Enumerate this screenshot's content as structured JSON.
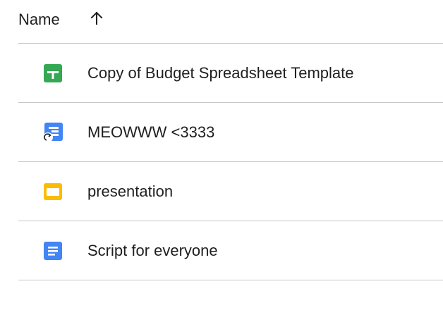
{
  "header": {
    "name_label": "Name",
    "sort_icon": "arrow-up-icon"
  },
  "files": [
    {
      "name": "Copy of Budget Spreadsheet Template",
      "icon": "sheets-icon",
      "color": "#34a853"
    },
    {
      "name": "MEOWWW <3333",
      "icon": "forms-shortcut-icon",
      "color": "#4285f4"
    },
    {
      "name": "presentation",
      "icon": "slides-icon",
      "color": "#fbbc04"
    },
    {
      "name": "Script for everyone",
      "icon": "docs-icon",
      "color": "#4285f4"
    }
  ]
}
